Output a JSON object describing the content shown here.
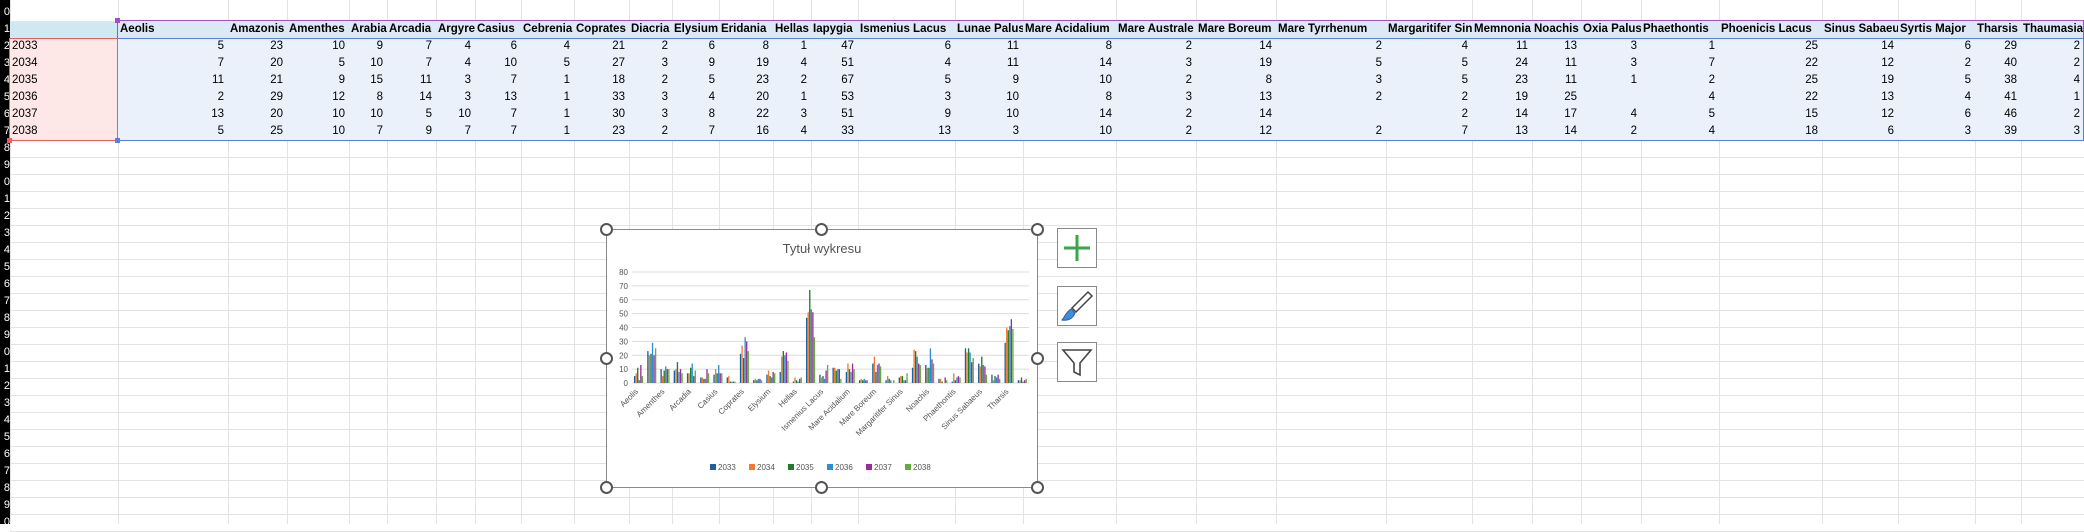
{
  "sheet": {
    "column_headers": [
      "Aeolis",
      "Amazonis",
      "Amenthes",
      "Arabia",
      "Arcadia",
      "Argyre",
      "Casius",
      "Cebrenia",
      "Coprates",
      "Diacria",
      "Elysium",
      "Eridania",
      "Hellas",
      "Iapygia",
      "Ismenius Lacus",
      "Lunae Palus",
      "Mare Acidalium",
      "Mare Australe",
      "Mare Boreum",
      "Mare Tyrrhenum",
      "Margaritifer Sinus",
      "Memnonia",
      "Noachis",
      "Oxia Palus",
      "Phaethontis",
      "Phoenicis Lacus",
      "Sinus Sabaeus",
      "Syrtis Major",
      "Tharsis",
      "Thaumasia"
    ],
    "row_numbers": [
      "0",
      "1",
      "2",
      "3",
      "4",
      "5",
      "6",
      "7",
      "8",
      "9",
      "0",
      "1",
      "2",
      "3",
      "4",
      "5",
      "6",
      "7",
      "8",
      "9",
      "0",
      "1",
      "2",
      "3",
      "4",
      "5",
      "6",
      "7",
      "8",
      "9",
      "0"
    ],
    "rows": [
      {
        "year": "2033",
        "values": [
          "5",
          "23",
          "10",
          "9",
          "7",
          "4",
          "6",
          "4",
          "21",
          "2",
          "6",
          "8",
          "1",
          "47",
          "6",
          "11",
          "8",
          "2",
          "14",
          "2",
          "4",
          "11",
          "13",
          "3",
          "1",
          "25",
          "14",
          "6",
          "29",
          "2"
        ]
      },
      {
        "year": "2034",
        "values": [
          "7",
          "20",
          "5",
          "10",
          "7",
          "4",
          "10",
          "5",
          "27",
          "3",
          "9",
          "19",
          "4",
          "51",
          "4",
          "11",
          "14",
          "3",
          "19",
          "5",
          "5",
          "24",
          "11",
          "3",
          "7",
          "22",
          "12",
          "2",
          "40",
          "2"
        ]
      },
      {
        "year": "2035",
        "values": [
          "11",
          "21",
          "9",
          "15",
          "11",
          "3",
          "7",
          "1",
          "18",
          "2",
          "5",
          "23",
          "2",
          "67",
          "5",
          "9",
          "10",
          "2",
          "8",
          "3",
          "5",
          "23",
          "11",
          "1",
          "2",
          "25",
          "19",
          "5",
          "38",
          "4"
        ]
      },
      {
        "year": "2036",
        "values": [
          "2",
          "29",
          "12",
          "8",
          "14",
          "3",
          "13",
          "1",
          "33",
          "3",
          "4",
          "20",
          "1",
          "53",
          "3",
          "10",
          "8",
          "3",
          "13",
          "2",
          "2",
          "19",
          "25",
          "",
          "4",
          "22",
          "13",
          "4",
          "41",
          "1"
        ]
      },
      {
        "year": "2037",
        "values": [
          "13",
          "20",
          "10",
          "10",
          "5",
          "10",
          "7",
          "1",
          "30",
          "3",
          "8",
          "22",
          "3",
          "51",
          "9",
          "10",
          "14",
          "2",
          "14",
          "",
          "2",
          "14",
          "17",
          "4",
          "5",
          "15",
          "12",
          "6",
          "46",
          "2"
        ]
      },
      {
        "year": "2038",
        "values": [
          "5",
          "25",
          "10",
          "7",
          "9",
          "7",
          "7",
          "1",
          "23",
          "2",
          "7",
          "16",
          "4",
          "33",
          "13",
          "3",
          "10",
          "2",
          "12",
          "2",
          "7",
          "13",
          "14",
          "2",
          "4",
          "18",
          "6",
          "3",
          "39",
          "3"
        ]
      }
    ]
  },
  "chart": {
    "side_buttons": {
      "add_icon": "plus-icon",
      "style_icon": "brush-icon",
      "filter_icon": "funnel-icon"
    }
  },
  "chart_data": {
    "type": "bar",
    "title": "Tytuł wykresu",
    "xlabel": "",
    "ylabel": "",
    "ylim": [
      0,
      80
    ],
    "yticks": [
      "0",
      "10",
      "20",
      "30",
      "40",
      "50",
      "60",
      "70",
      "80"
    ],
    "grid": true,
    "legend_placement": "bottom",
    "categories": [
      "Aeolis",
      "Amazonis",
      "Amenthes",
      "Arabia",
      "Arcadia",
      "Argyre",
      "Casius",
      "Cebrenia",
      "Coprates",
      "Diacria",
      "Elysium",
      "Eridania",
      "Hellas",
      "Iapygia",
      "Ismenius Lacus",
      "Lunae Palus",
      "Mare Acidalium",
      "Mare Australe",
      "Mare Boreum",
      "Mare Tyrrhenum",
      "Margaritifer Sinus",
      "Memnonia",
      "Noachis",
      "Oxia Palus",
      "Phaethontis",
      "Phoenicis Lacus",
      "Sinus Sabaeus",
      "Syrtis Major",
      "Tharsis",
      "Thaumasia"
    ],
    "shown_category_labels": [
      "Aeolis",
      "Amenthes",
      "Arcadia",
      "Casius",
      "Coprates",
      "Elysium",
      "Hellas",
      "Ismenius Lacus",
      "Mare Acidalium",
      "Mare Boreum",
      "Margaritifer Sinus",
      "Noachis",
      "Phaethontis",
      "Sinus Sabaeus",
      "Tharsis"
    ],
    "series": [
      {
        "name": "2033",
        "color": "#1f5f9f",
        "values": [
          5,
          23,
          10,
          9,
          7,
          4,
          6,
          4,
          21,
          2,
          6,
          8,
          1,
          47,
          6,
          11,
          8,
          2,
          14,
          2,
          4,
          11,
          13,
          3,
          1,
          25,
          14,
          6,
          29,
          2
        ]
      },
      {
        "name": "2034",
        "color": "#f07b2e",
        "values": [
          7,
          20,
          5,
          10,
          7,
          4,
          10,
          5,
          27,
          3,
          9,
          19,
          4,
          51,
          4,
          11,
          14,
          3,
          19,
          5,
          5,
          24,
          11,
          3,
          7,
          22,
          12,
          2,
          40,
          2
        ]
      },
      {
        "name": "2035",
        "color": "#1f7a2a",
        "values": [
          11,
          21,
          9,
          15,
          11,
          3,
          7,
          1,
          18,
          2,
          5,
          23,
          2,
          67,
          5,
          9,
          10,
          2,
          8,
          3,
          5,
          23,
          11,
          1,
          2,
          25,
          19,
          5,
          38,
          4
        ]
      },
      {
        "name": "2036",
        "color": "#2a8fd6",
        "values": [
          2,
          29,
          12,
          8,
          14,
          3,
          13,
          1,
          33,
          3,
          4,
          20,
          1,
          53,
          3,
          10,
          8,
          3,
          13,
          2,
          2,
          19,
          25,
          0,
          4,
          22,
          13,
          4,
          41,
          1
        ]
      },
      {
        "name": "2037",
        "color": "#9c2a9c",
        "values": [
          13,
          20,
          10,
          10,
          5,
          10,
          7,
          1,
          30,
          3,
          8,
          22,
          3,
          51,
          9,
          10,
          14,
          2,
          14,
          0,
          2,
          14,
          17,
          4,
          5,
          15,
          12,
          6,
          46,
          2
        ]
      },
      {
        "name": "2038",
        "color": "#5fae3a",
        "values": [
          5,
          25,
          10,
          7,
          9,
          7,
          7,
          1,
          23,
          2,
          7,
          16,
          4,
          33,
          13,
          3,
          10,
          2,
          12,
          2,
          7,
          13,
          14,
          2,
          4,
          18,
          6,
          3,
          39,
          3
        ]
      }
    ]
  }
}
